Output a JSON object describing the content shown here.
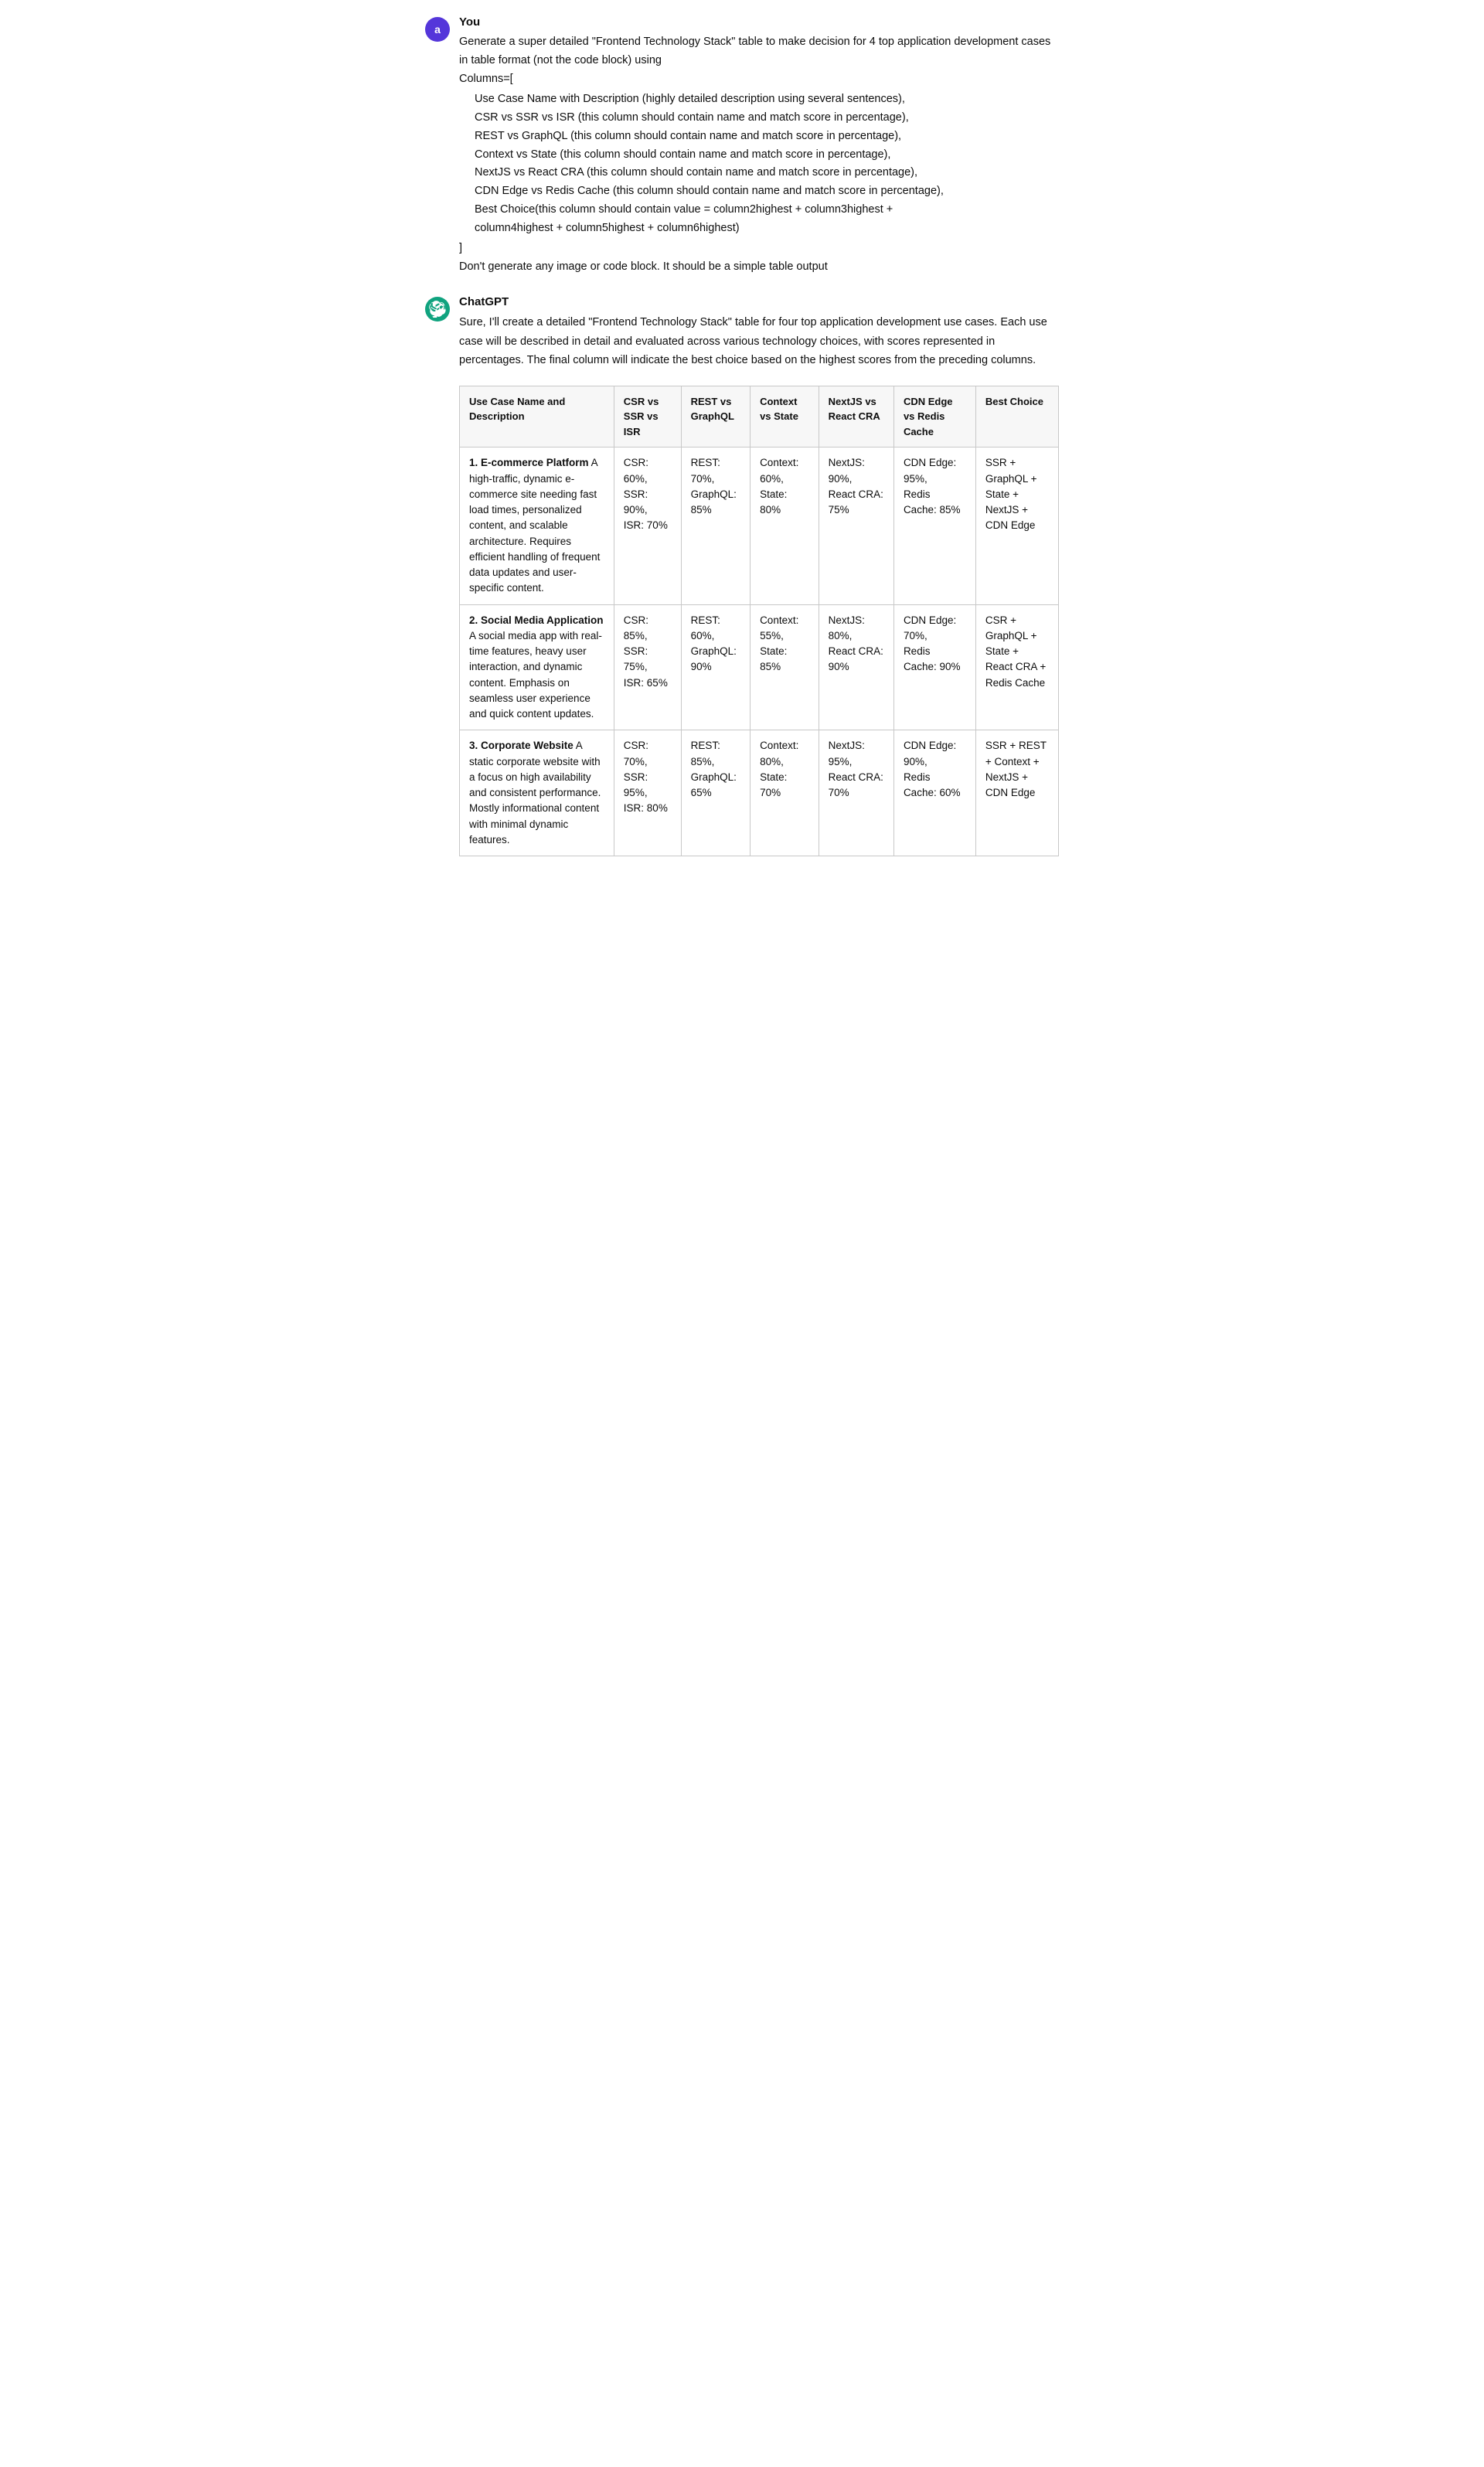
{
  "user": {
    "avatar_label": "a",
    "name": "You",
    "prompt_lines": [
      "Generate a super detailed \"Frontend Technology Stack\" table to make decision for 4 top",
      "application development cases in table format (not the code block) using",
      "Columns=["
    ],
    "columns_list": [
      "Use Case Name with Description (highly detailed description using several sentences),",
      "CSR vs SSR vs ISR (this column should contain name and match score in percentage),",
      "REST vs GraphQL (this column should contain name and match score in percentage),",
      "Context vs State (this column should contain name and match score in percentage),",
      "NextJS vs React CRA (this column should contain name and match score in percentage),",
      "CDN Edge vs Redis Cache (this column should contain name and match score in percentage),",
      "Best Choice(this column should contain value = column2highest + column3highest +",
      "column4highest + column5highest + column6highest)"
    ],
    "closing_bracket": "]",
    "footer_note": "Don't generate any image or code block. It should be a simple table output"
  },
  "assistant": {
    "name": "ChatGPT",
    "intro": "Sure, I'll create a detailed \"Frontend Technology Stack\" table for four top application development use cases. Each use case will be described in detail and evaluated across various technology choices, with scores represented in percentages. The final column will indicate the best choice based on the highest scores from the preceding columns.",
    "table": {
      "headers": [
        "Use Case Name and Description",
        "CSR vs SSR vs ISR",
        "REST vs GraphQL",
        "Context vs State",
        "NextJS vs React CRA",
        "CDN Edge vs Redis Cache",
        "Best Choice"
      ],
      "rows": [
        {
          "use_case": "1. E-commerce Platform",
          "use_case_bold": "1. E-commerce Platform",
          "description": " A high-traffic, dynamic e-commerce site needing fast load times, personalized content, and scalable architecture. Requires efficient handling of frequent data updates and user-specific content.",
          "csr_ssr_isr": "CSR: 60%, SSR: 90%, ISR: 70%",
          "rest_graphql": "REST: 70%, GraphQL: 85%",
          "context_state": "Context: 60%, State: 80%",
          "nextjs_react": "NextJS: 90%, React CRA: 75%",
          "cdn_redis": "CDN Edge: 95%, Redis Cache: 85%",
          "best_choice": "SSR + GraphQL + State + NextJS + CDN Edge"
        },
        {
          "use_case": "2. Social Media Application",
          "use_case_bold": "2. Social Media Application",
          "description": " A social media app with real-time features, heavy user interaction, and dynamic content. Emphasis on seamless user experience and quick content updates.",
          "csr_ssr_isr": "CSR: 85%, SSR: 75%, ISR: 65%",
          "rest_graphql": "REST: 60%, GraphQL: 90%",
          "context_state": "Context: 55%, State: 85%",
          "nextjs_react": "NextJS: 80%, React CRA: 90%",
          "cdn_redis": "CDN Edge: 70%, Redis Cache: 90%",
          "best_choice": "CSR + GraphQL + State + React CRA + Redis Cache"
        },
        {
          "use_case": "3. Corporate Website",
          "use_case_bold": "3. Corporate Website",
          "description": " A static corporate website with a focus on high availability and consistent performance. Mostly informational content with minimal dynamic features.",
          "csr_ssr_isr": "CSR: 70%, SSR: 95%, ISR: 80%",
          "rest_graphql": "REST: 85%, GraphQL: 65%",
          "context_state": "Context: 80%, State: 70%",
          "nextjs_react": "NextJS: 95%, React CRA: 70%",
          "cdn_redis": "CDN Edge: 90%, Redis Cache: 60%",
          "best_choice": "SSR + REST + Context + NextJS + CDN Edge"
        }
      ]
    }
  }
}
